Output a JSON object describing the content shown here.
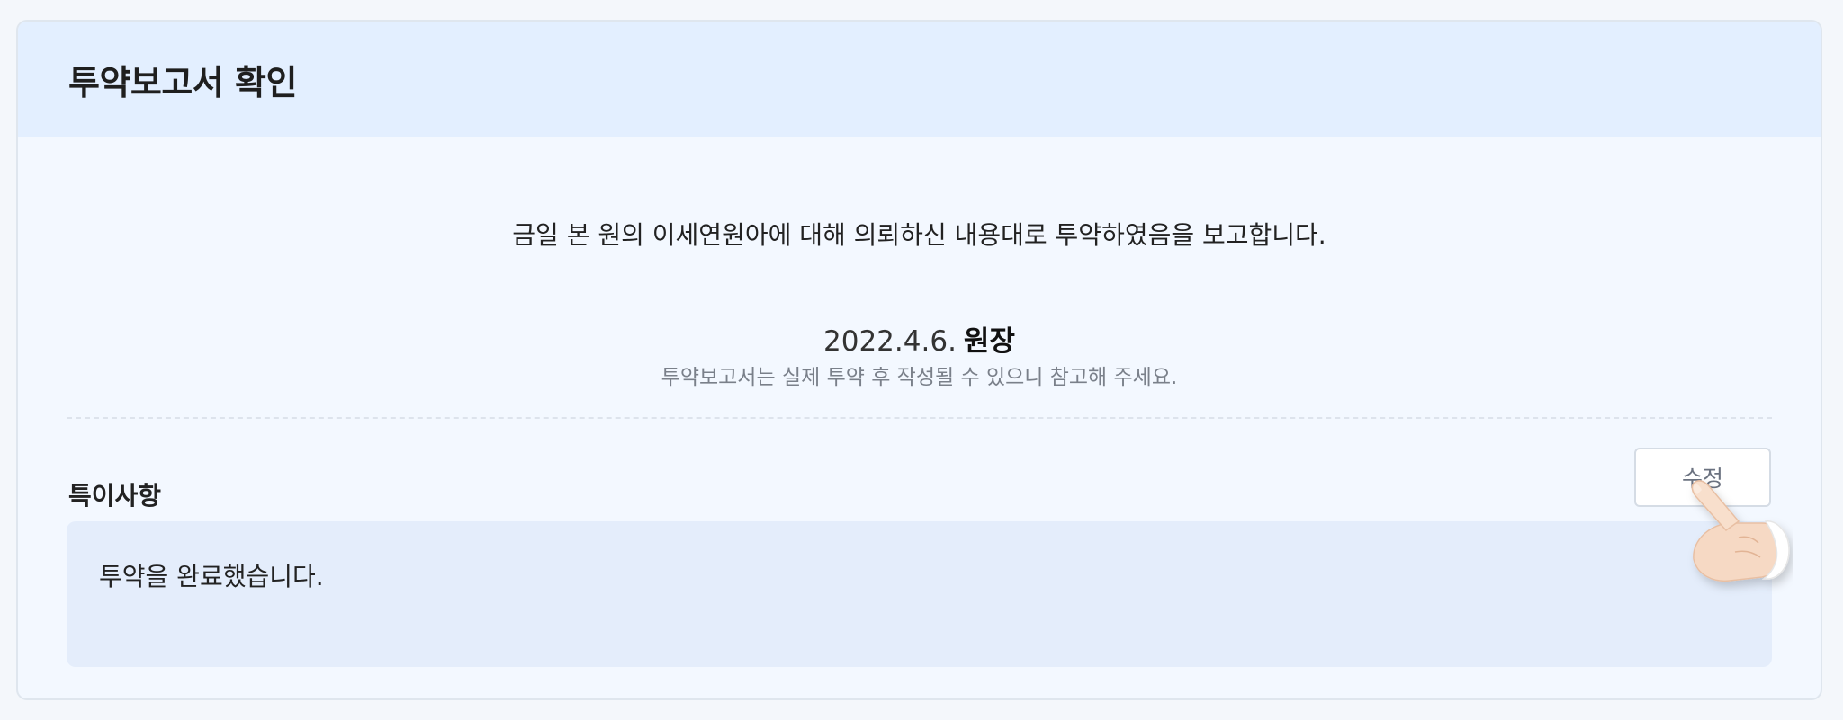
{
  "dialog": {
    "title": "투약보고서 확인"
  },
  "report": {
    "message": "금일 본 원의 이세연원아에 대해 의뢰하신 내용대로 투약하였음을 보고합니다.",
    "date": "2022.4.6.",
    "signer": "원장",
    "note": "투약보고서는 실제 투약 후 작성될 수 있으니 참고해 주세요."
  },
  "remarks": {
    "label": "특이사항",
    "edit_label": "수정",
    "content": "투약을 완료했습니다."
  },
  "icons": {
    "pointer": "hand-pointer-icon"
  },
  "colors": {
    "header_bg": "#e3efff",
    "card_bg": "#f3f8ff",
    "remarks_bg": "#e4edfb"
  }
}
